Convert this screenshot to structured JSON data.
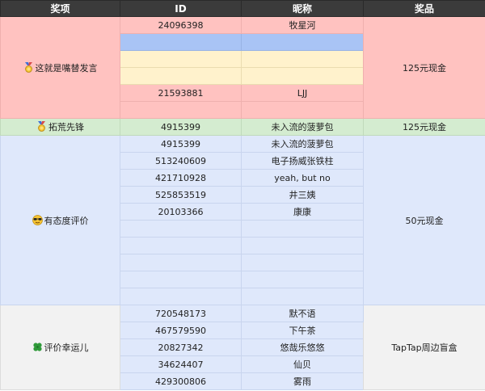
{
  "headers": [
    "奖项",
    "ID",
    "昵称",
    "奖品"
  ],
  "groups": [
    {
      "award": "这就是嘴替发言",
      "icon": "medal-icon",
      "prize": "125元现金",
      "rows": [
        {
          "id": "24096398",
          "nick": "牧星河",
          "style": "pink"
        },
        {
          "id": "",
          "nick": "",
          "style": "blue"
        },
        {
          "id": "",
          "nick": "",
          "style": "yellow"
        },
        {
          "id": "",
          "nick": "",
          "style": "yellow"
        },
        {
          "id": "21593881",
          "nick": "LJJ",
          "style": "pink"
        },
        {
          "id": "",
          "nick": "",
          "style": "pink"
        }
      ]
    },
    {
      "award": "拓荒先锋",
      "icon": "medal-icon",
      "prize": "125元现金",
      "rows": [
        {
          "id": "4915399",
          "nick": "未入流的菠萝包",
          "style": "green"
        }
      ]
    },
    {
      "award": "有态度评价",
      "icon": "sunglasses-face-icon",
      "prize": "50元现金",
      "rows": [
        {
          "id": "4915399",
          "nick": "未入流的菠萝包"
        },
        {
          "id": "513240609",
          "nick": "电子扬威张铁柱"
        },
        {
          "id": "421710928",
          "nick": "yeah, but no"
        },
        {
          "id": "525853519",
          "nick": "井三姨"
        },
        {
          "id": "20103366",
          "nick": "康康"
        },
        {
          "id": "",
          "nick": ""
        },
        {
          "id": "",
          "nick": ""
        },
        {
          "id": "",
          "nick": ""
        },
        {
          "id": "",
          "nick": ""
        },
        {
          "id": "",
          "nick": ""
        }
      ]
    },
    {
      "award": "评价幸运儿",
      "icon": "four-leaf-clover-icon",
      "prize": "TapTap周边盲盒",
      "rows": [
        {
          "id": "720548173",
          "nick": "默不语"
        },
        {
          "id": "467579590",
          "nick": "下午茶"
        },
        {
          "id": "20827342",
          "nick": "悠哉乐悠悠"
        },
        {
          "id": "34624407",
          "nick": "仙贝"
        },
        {
          "id": "429300806",
          "nick": "雾雨"
        }
      ]
    }
  ]
}
